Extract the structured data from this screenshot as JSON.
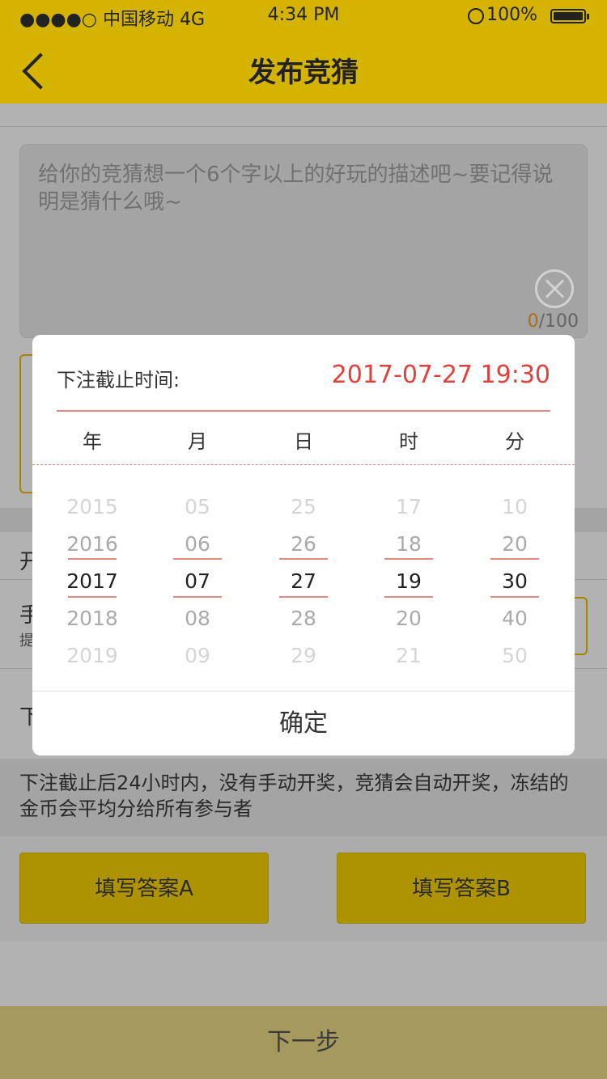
{
  "statusbar": {
    "carrier": "●●●●○ 中国移动 4G",
    "time": "4:34 PM",
    "battery": "100%"
  },
  "navbar": {
    "title": "发布竞猜"
  },
  "description": {
    "placeholder": "给你的竞猜想一个6个字以上的好玩的描述吧~要记得说明是猜什么哦~",
    "count_current": "0",
    "count_max": "/100"
  },
  "background_rows": {
    "peek1": "开",
    "peek2": "手",
    "peek2_sub": "提",
    "peek3": "下"
  },
  "notice": "下注截止后24小时内，没有手动开奖，竞猜会自动开奖，冻结的金币会平均分给所有参与者",
  "answers": {
    "a": "填写答案A",
    "b": "填写答案B"
  },
  "next_button": "下一步",
  "picker": {
    "label": "下注截止时间:",
    "value": "2017-07-27 19:30",
    "columns": [
      "年",
      "月",
      "日",
      "时",
      "分"
    ],
    "wheels": [
      [
        "2015",
        "2016",
        "2017",
        "2018",
        "2019"
      ],
      [
        "05",
        "06",
        "07",
        "08",
        "09"
      ],
      [
        "25",
        "26",
        "27",
        "28",
        "29"
      ],
      [
        "17",
        "18",
        "19",
        "20",
        "21"
      ],
      [
        "10",
        "20",
        "30",
        "40",
        "50"
      ]
    ],
    "confirm": "确定"
  },
  "colors": {
    "brand": "#d4b400",
    "accent_red": "#e0413b",
    "divider_red": "#e08a84"
  }
}
